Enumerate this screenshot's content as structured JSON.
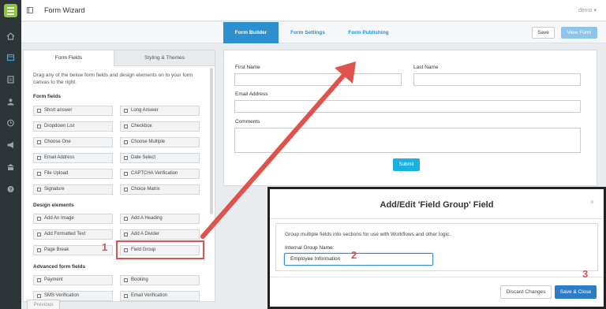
{
  "app": {
    "title": "Form Wizard",
    "user": "demo ▾"
  },
  "rail_icons": [
    "home-icon",
    "forms-icon",
    "document-icon",
    "user-icon",
    "history-icon",
    "megaphone-icon",
    "building-icon",
    "help-icon"
  ],
  "tabs": [
    {
      "label": "Form Builder",
      "active": true
    },
    {
      "label": "Form Settings",
      "active": false
    },
    {
      "label": "Form Publishing",
      "active": false
    }
  ],
  "toolbar": {
    "save_label": "Save",
    "view_label": "View Form"
  },
  "left_panel": {
    "tab_fields": "Form Fields",
    "tab_styling": "Styling & Themes",
    "description": "Drag any of the below form fields and design elements on to your form canvas to the right.",
    "sections": {
      "form_fields": "Form fields",
      "design_elements": "Design elements",
      "advanced": "Advanced form fields"
    },
    "form_fields": [
      "Short answer",
      "Long Answer",
      "Dropdown List",
      "Checkbox",
      "Choose One",
      "Choose Multiple",
      "Email Address",
      "Date Select",
      "File Upload",
      "CAPTCHA Verification",
      "Signature",
      "Choice Matrix"
    ],
    "design_elements": [
      "Add An Image",
      "Add A Heading",
      "Add Formatted Text",
      "Add A Divider",
      "Page Break",
      "Field Group"
    ],
    "advanced_fields": [
      "Payment",
      "Booking",
      "SMS Verification",
      "Email Verification"
    ],
    "previous_label": "Previous"
  },
  "canvas": {
    "first_name": "First Name",
    "last_name": "Last Name",
    "email": "Email Address",
    "comments": "Comments",
    "submit": "Submit"
  },
  "annotations": {
    "n1": "1",
    "n2": "2",
    "n3": "3"
  },
  "modal": {
    "title": "Add/Edit 'Field Group' Field",
    "close": "×",
    "help": "Group multiple fields into sections for use with Workflows and other logic.",
    "label": "Internal Group Name:",
    "value": "Employee Information",
    "discard": "Discard Changes",
    "save": "Save & Close"
  },
  "colors": {
    "accent": "#2b8fd0",
    "highlight": "#d9534f",
    "logo": "#8cc63f",
    "rail": "#2d3539"
  }
}
